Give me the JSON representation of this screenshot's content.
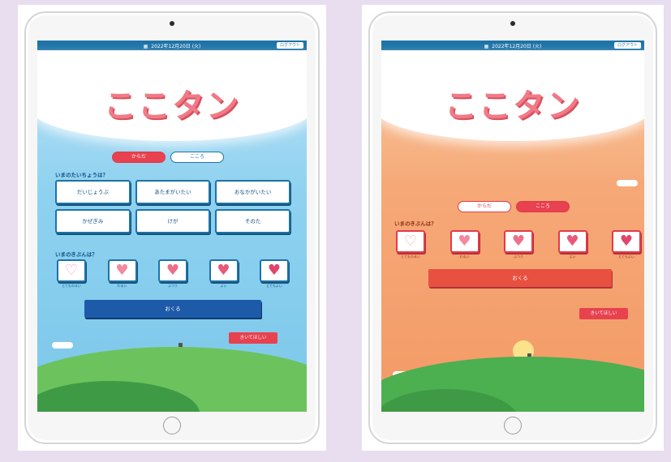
{
  "left": {
    "date": "2022年12月20日 (火)",
    "logout": "ログアウト",
    "logo": "ここタン",
    "tabs": [
      "からだ",
      "こころ"
    ],
    "symptom_question": "いまのたいちょうは？",
    "symptoms": [
      "だいじょうぶ",
      "あたまがいたい",
      "おなかがいたい",
      "かぜぎみ",
      "けが",
      "そのた"
    ],
    "feeling_question": "いまのきぶんは？",
    "feelings": [
      {
        "label": "とてもわるい",
        "heart": "♡"
      },
      {
        "label": "わるい",
        "heart": "♥"
      },
      {
        "label": "ふつう",
        "heart": "♥"
      },
      {
        "label": "よい",
        "heart": "♥"
      },
      {
        "label": "とてもよい",
        "heart": "♥"
      }
    ],
    "send": "おくる",
    "talk": "きいてほしい"
  },
  "right": {
    "date": "2022年12月20日 (火)",
    "logout": "ログアウト",
    "logo": "ここタン",
    "tabs": [
      "からだ",
      "こころ"
    ],
    "feeling_question": "いまのきぶんは？",
    "feelings": [
      {
        "label": "とてもわるい",
        "heart": "♡"
      },
      {
        "label": "わるい",
        "heart": "♥"
      },
      {
        "label": "ふつう",
        "heart": "♥"
      },
      {
        "label": "よい",
        "heart": "♥"
      },
      {
        "label": "とてもよい",
        "heart": "♥"
      }
    ],
    "send": "おくる",
    "talk": "きいてほしい"
  },
  "colors": {
    "accent_red": "#e8414f",
    "accent_blue": "#1d73a8",
    "sky_blue": "#8fd2f0",
    "sunset_orange": "#f6a877",
    "hill_green": "#4caf50"
  }
}
